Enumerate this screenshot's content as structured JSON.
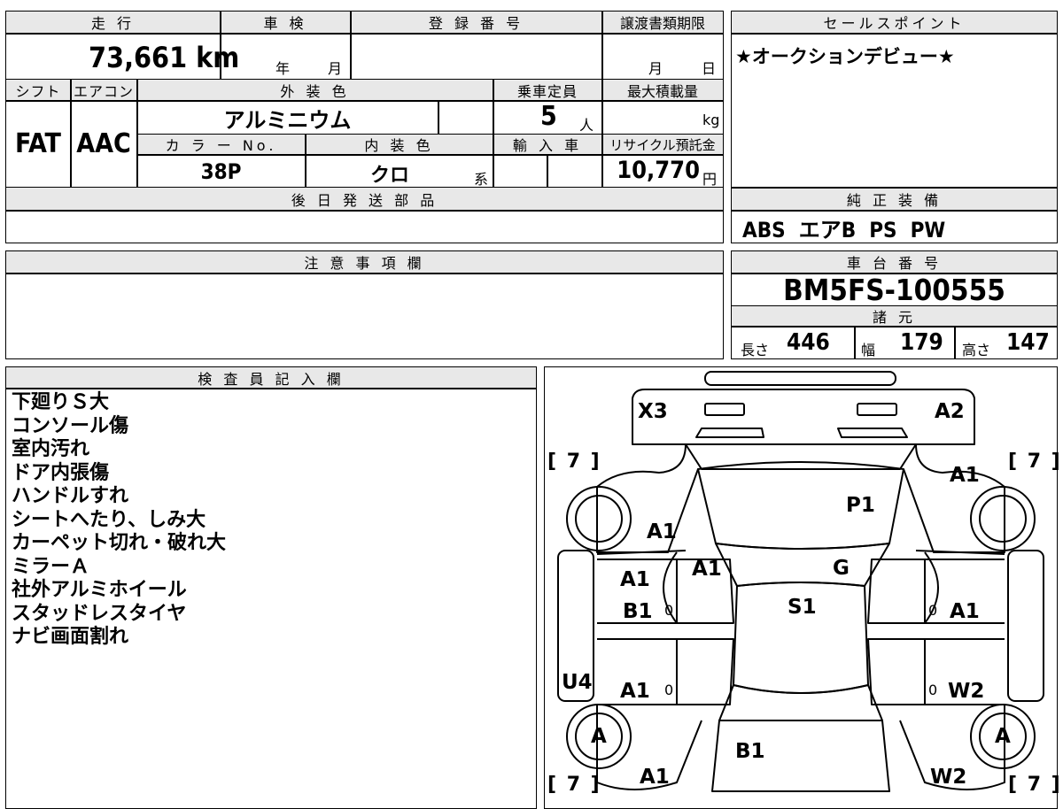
{
  "top": {
    "mileage": {
      "label": "走 行",
      "value": "73,661",
      "unit": "km"
    },
    "inspection": {
      "label": "車 検",
      "year": "年",
      "month": "月"
    },
    "registration": {
      "label": "登 録 番 号",
      "value": ""
    },
    "transfer_deadline": {
      "label": "譲渡書類期限",
      "month": "月",
      "day": "日"
    },
    "shift": {
      "label": "シフト",
      "value": "FAT"
    },
    "aircon": {
      "label": "エアコン",
      "value": "AAC"
    },
    "exterior_color": {
      "label": "外 装 色",
      "value": "アルミニウム"
    },
    "capacity": {
      "label": "乗車定員",
      "value": "5",
      "unit": "人"
    },
    "max_load": {
      "label": "最大積載量",
      "value": "",
      "unit": "kg"
    },
    "color_no": {
      "label": "カ ラ ー No.",
      "value": "38P"
    },
    "interior_color": {
      "label": "内 装 色",
      "value": "クロ",
      "suffix": "系"
    },
    "import": {
      "label": "輸 入 車",
      "value": ""
    },
    "recycle": {
      "label": "リサイクル預託金",
      "value": "10,770",
      "unit": "円"
    },
    "later_parts": {
      "label": "後 日 発 送 部 品",
      "value": ""
    }
  },
  "sales_point": {
    "label": "セールスポイント",
    "text": "★オークションデビュー★"
  },
  "equipment": {
    "label": "純 正 装 備",
    "text": "ABS  エアB  PS  PW"
  },
  "caution": {
    "label": "注 意 事 項 欄",
    "text": ""
  },
  "chassis": {
    "label": "車 台 番 号",
    "value": "BM5FS-100555"
  },
  "specs": {
    "label": "諸 元",
    "length_label": "長さ",
    "length": "446",
    "width_label": "幅",
    "width": "179",
    "height_label": "高さ",
    "height": "147"
  },
  "inspector": {
    "label": "検 査 員 記 入 欄",
    "notes": [
      "下廻りＳ大",
      "コンソール傷",
      "室内汚れ",
      "ドア内張傷",
      "ハンドルすれ",
      "シートへたり、しみ大",
      "カーペット切れ・破れ大",
      "ミラーＡ",
      "社外アルミホイール",
      "スタッドレスタイヤ",
      "ナビ画面割れ"
    ]
  },
  "diagram": {
    "tread_front_left": "[ 7 ]",
    "tread_front_right": "[ 7 ]",
    "tread_rear_left": "[ 7 ]",
    "tread_rear_right": "[ 7 ]",
    "marks": {
      "front_left_corner": "X3",
      "front_right_corner": "A2",
      "right_fender": "A1",
      "hood": "P1",
      "left_fender": "A1",
      "left_pillar": "A1",
      "windshield": "G",
      "left_front_door_top": "A1",
      "left_front_door": "B1",
      "roof": "S1",
      "right_front_door": "A1",
      "left_sill": "U4",
      "left_rear_door": "A1",
      "right_rear_door": "W2",
      "left_wheel": "A",
      "right_wheel": "A",
      "trunk": "B1",
      "left_rear_quarter": "A1",
      "right_rear_quarter": "W2",
      "zero_1": "0",
      "zero_2": "0",
      "zero_3": "0",
      "zero_4": "0"
    }
  }
}
